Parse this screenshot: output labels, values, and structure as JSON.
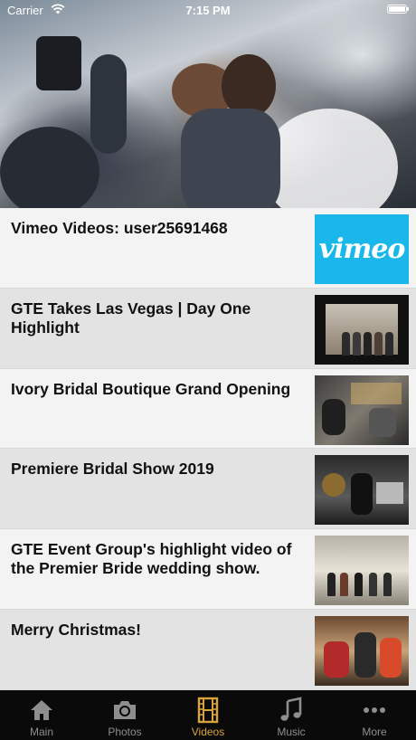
{
  "status_bar": {
    "carrier": "Carrier",
    "time": "7:15 PM",
    "wifi_icon": "wifi-icon",
    "battery_icon": "battery-full-icon"
  },
  "hero": {
    "image": "wedding-couple-photo"
  },
  "videos": [
    {
      "title": "Vimeo Videos: user25691468",
      "thumbnail": "vimeo-logo",
      "thumb_text": "vimeo",
      "thumb_color": "#1ab7ea"
    },
    {
      "title": "GTE Takes Las Vegas | Day One Highlight",
      "thumbnail": "group-in-las-vegas"
    },
    {
      "title": "Ivory Bridal Boutique Grand Opening",
      "thumbnail": "boutique-event-crowd"
    },
    {
      "title": "Premiere Bridal Show 2019",
      "thumbnail": "bridal-show-stage"
    },
    {
      "title": "GTE Event Group's highlight video of the Premier Bride wedding show.",
      "thumbnail": "wedding-show-hall"
    },
    {
      "title": "Merry Christmas!",
      "thumbnail": "christmas-group"
    }
  ],
  "tab_bar": {
    "active_color": "#d7a33a",
    "inactive_color": "#8e8e8e",
    "tabs": [
      {
        "label": "Main",
        "icon": "home-icon",
        "active": false
      },
      {
        "label": "Photos",
        "icon": "camera-icon",
        "active": false
      },
      {
        "label": "Videos",
        "icon": "film-icon",
        "active": true
      },
      {
        "label": "Music",
        "icon": "music-note-icon",
        "active": false
      },
      {
        "label": "More",
        "icon": "more-dots-icon",
        "active": false
      }
    ]
  }
}
